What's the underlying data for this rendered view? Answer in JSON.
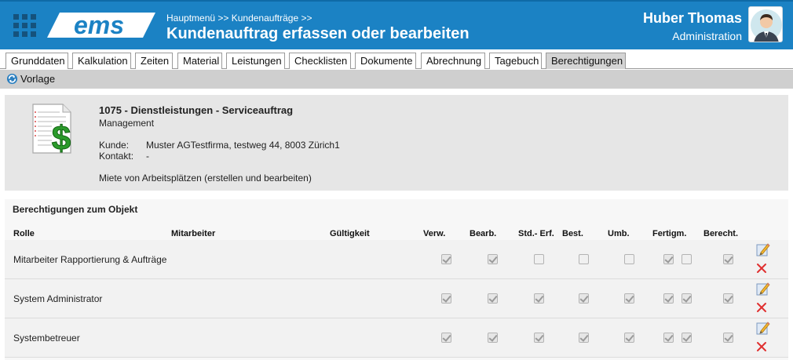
{
  "header": {
    "logo_text": "ems",
    "breadcrumb": "Hauptmenü >> Kundenaufträge >>",
    "title": "Kundenauftrag erfassen oder bearbeiten",
    "user_name": "Huber Thomas",
    "user_role": "Administration"
  },
  "tabs": [
    {
      "label": "Grunddaten"
    },
    {
      "label": "Kalkulation"
    },
    {
      "label": "Zeiten"
    },
    {
      "label": "Material"
    },
    {
      "label": "Leistungen"
    },
    {
      "label": "Checklisten"
    },
    {
      "label": "Dokumente"
    },
    {
      "label": "Abrechnung"
    },
    {
      "label": "Tagebuch"
    },
    {
      "label": "Berechtigungen",
      "active": true
    }
  ],
  "toolbar": {
    "vorlage_label": "Vorlage"
  },
  "object": {
    "title": "1075 - Dienstleistungen - Serviceauftrag",
    "subtitle": "Management",
    "kunde_label": "Kunde:",
    "kunde_value": "Muster AGTestfirma, testweg 44, 8003 Zürich1",
    "kontakt_label": "Kontakt:",
    "kontakt_value": "-",
    "description": "Miete von Arbeitsplätzen (erstellen und bearbeiten)"
  },
  "permissions": {
    "title": "Berechtigungen zum Objekt",
    "columns": {
      "rolle": "Rolle",
      "mitarbeiter": "Mitarbeiter",
      "gueltigkeit": "Gültigkeit",
      "verw": "Verw.",
      "bearb": "Bearb.",
      "std_erf": "Std.- Erf.",
      "best": "Best.",
      "umb": "Umb.",
      "fertigm": "Fertigm.",
      "berecht": "Berecht."
    },
    "rows": [
      {
        "rolle": "Mitarbeiter Rapportierung & Aufträge",
        "verw": true,
        "bearb": true,
        "std_erf": false,
        "best": false,
        "umb": false,
        "fertigm_a": true,
        "fertigm_b": false,
        "berecht": true
      },
      {
        "rolle": "System Administrator",
        "verw": true,
        "bearb": true,
        "std_erf": true,
        "best": true,
        "umb": true,
        "fertigm_a": true,
        "fertigm_b": true,
        "berecht": true
      },
      {
        "rolle": "Systembetreuer",
        "verw": true,
        "bearb": true,
        "std_erf": true,
        "best": true,
        "umb": true,
        "fertigm_a": true,
        "fertigm_b": true,
        "berecht": true
      }
    ]
  },
  "icons": {
    "menu": "grid-menu-icon",
    "vorlage": "refresh-icon",
    "document": "document-dollar-icon",
    "edit": "pencil-edit-icon",
    "delete": "delete-x-icon"
  },
  "colors": {
    "header_bg": "#1b82c4",
    "grid_icon": "#15527c",
    "panel_bg": "#e6e6e6",
    "delete": "#e03030",
    "dollar": "#2a9a2a"
  }
}
